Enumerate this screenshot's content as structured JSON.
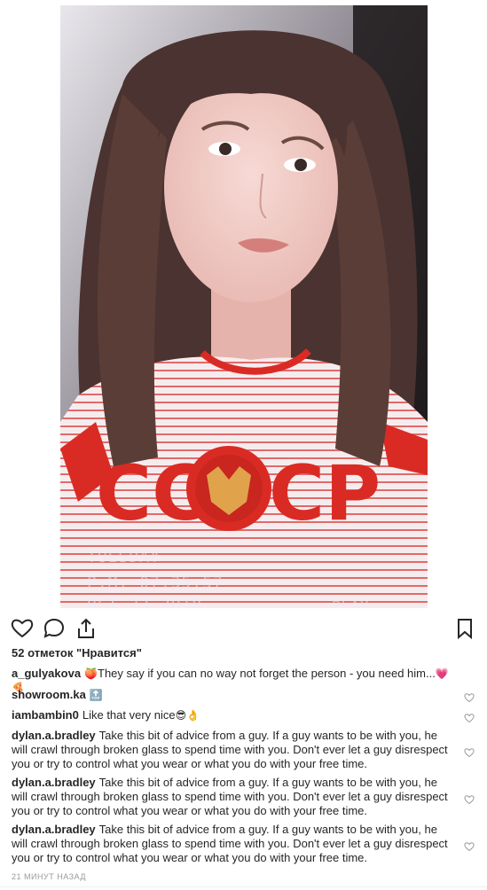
{
  "post": {
    "overlay": {
      "day": "TUESDAY",
      "time": "P.M. 07:35:57",
      "date": "OCT 23 2018",
      "rec": "PLAY"
    }
  },
  "actions": {
    "like_icon": "heart-outline-icon",
    "comment_icon": "speech-bubble-icon",
    "share_icon": "share-upload-icon",
    "save_icon": "bookmark-icon"
  },
  "likes": "52 отметок \"Нравится\"",
  "comments": [
    {
      "user": "a_gulyakova",
      "emoji_before": "🍑",
      "text": "They say if you can no way not forget the person - you need him...",
      "emoji_after": "💗🍕"
    },
    {
      "user": "showroom.ka",
      "text": "",
      "emoji_after": "🔝"
    },
    {
      "user": "iambambin0",
      "text": "Like that very nice",
      "emoji_after": "😎👌"
    },
    {
      "user": "dylan.a.bradley",
      "text": "Take this bit of advice from a guy. If a guy wants to be with you, he will crawl through broken glass to spend time with you. Don't ever let a guy disrespect you or try to control what you wear or what you do with your free time."
    },
    {
      "user": "dylan.a.bradley",
      "text": "Take this bit of advice from a guy. If a guy wants to be with you, he will crawl through broken glass to spend time with you. Don't ever let a guy disrespect you or try to control what you wear or what you do with your free time."
    },
    {
      "user": "dylan.a.bradley",
      "text": "Take this bit of advice from a guy. If a guy wants to be with you, he will crawl through broken glass to spend time with you. Don't ever let a guy disrespect you or try to control what you wear or what you do with your free time."
    }
  ],
  "time_ago": "21 МИНУТ НАЗАД",
  "colors": {
    "text": "#262626",
    "muted": "#999999",
    "shirt_red": "#d92b24"
  }
}
